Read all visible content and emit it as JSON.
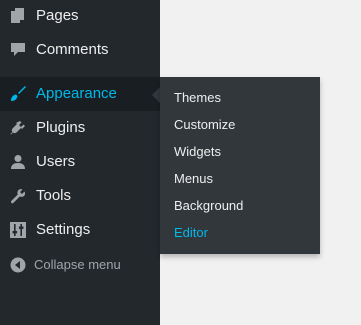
{
  "colors": {
    "sidebar_bg": "#23282d",
    "active_bg": "#191e23",
    "submenu_bg": "#32373c",
    "text": "#eeeeee",
    "accent": "#00b9eb",
    "icon": "#a0a5aa",
    "content_bg": "#f1f1f1"
  },
  "menu": [
    {
      "label": "Pages",
      "icon": "pages-icon"
    },
    {
      "label": "Comments",
      "icon": "comment-icon"
    },
    {
      "label": "Appearance",
      "icon": "paintbrush-icon",
      "active": true
    },
    {
      "label": "Plugins",
      "icon": "plug-icon"
    },
    {
      "label": "Users",
      "icon": "user-icon"
    },
    {
      "label": "Tools",
      "icon": "wrench-icon"
    },
    {
      "label": "Settings",
      "icon": "sliders-icon"
    }
  ],
  "collapse": {
    "label": "Collapse menu",
    "icon": "collapse-arrow-icon"
  },
  "submenu": [
    {
      "label": "Themes"
    },
    {
      "label": "Customize"
    },
    {
      "label": "Widgets"
    },
    {
      "label": "Menus"
    },
    {
      "label": "Background"
    },
    {
      "label": "Editor",
      "current": true
    }
  ]
}
